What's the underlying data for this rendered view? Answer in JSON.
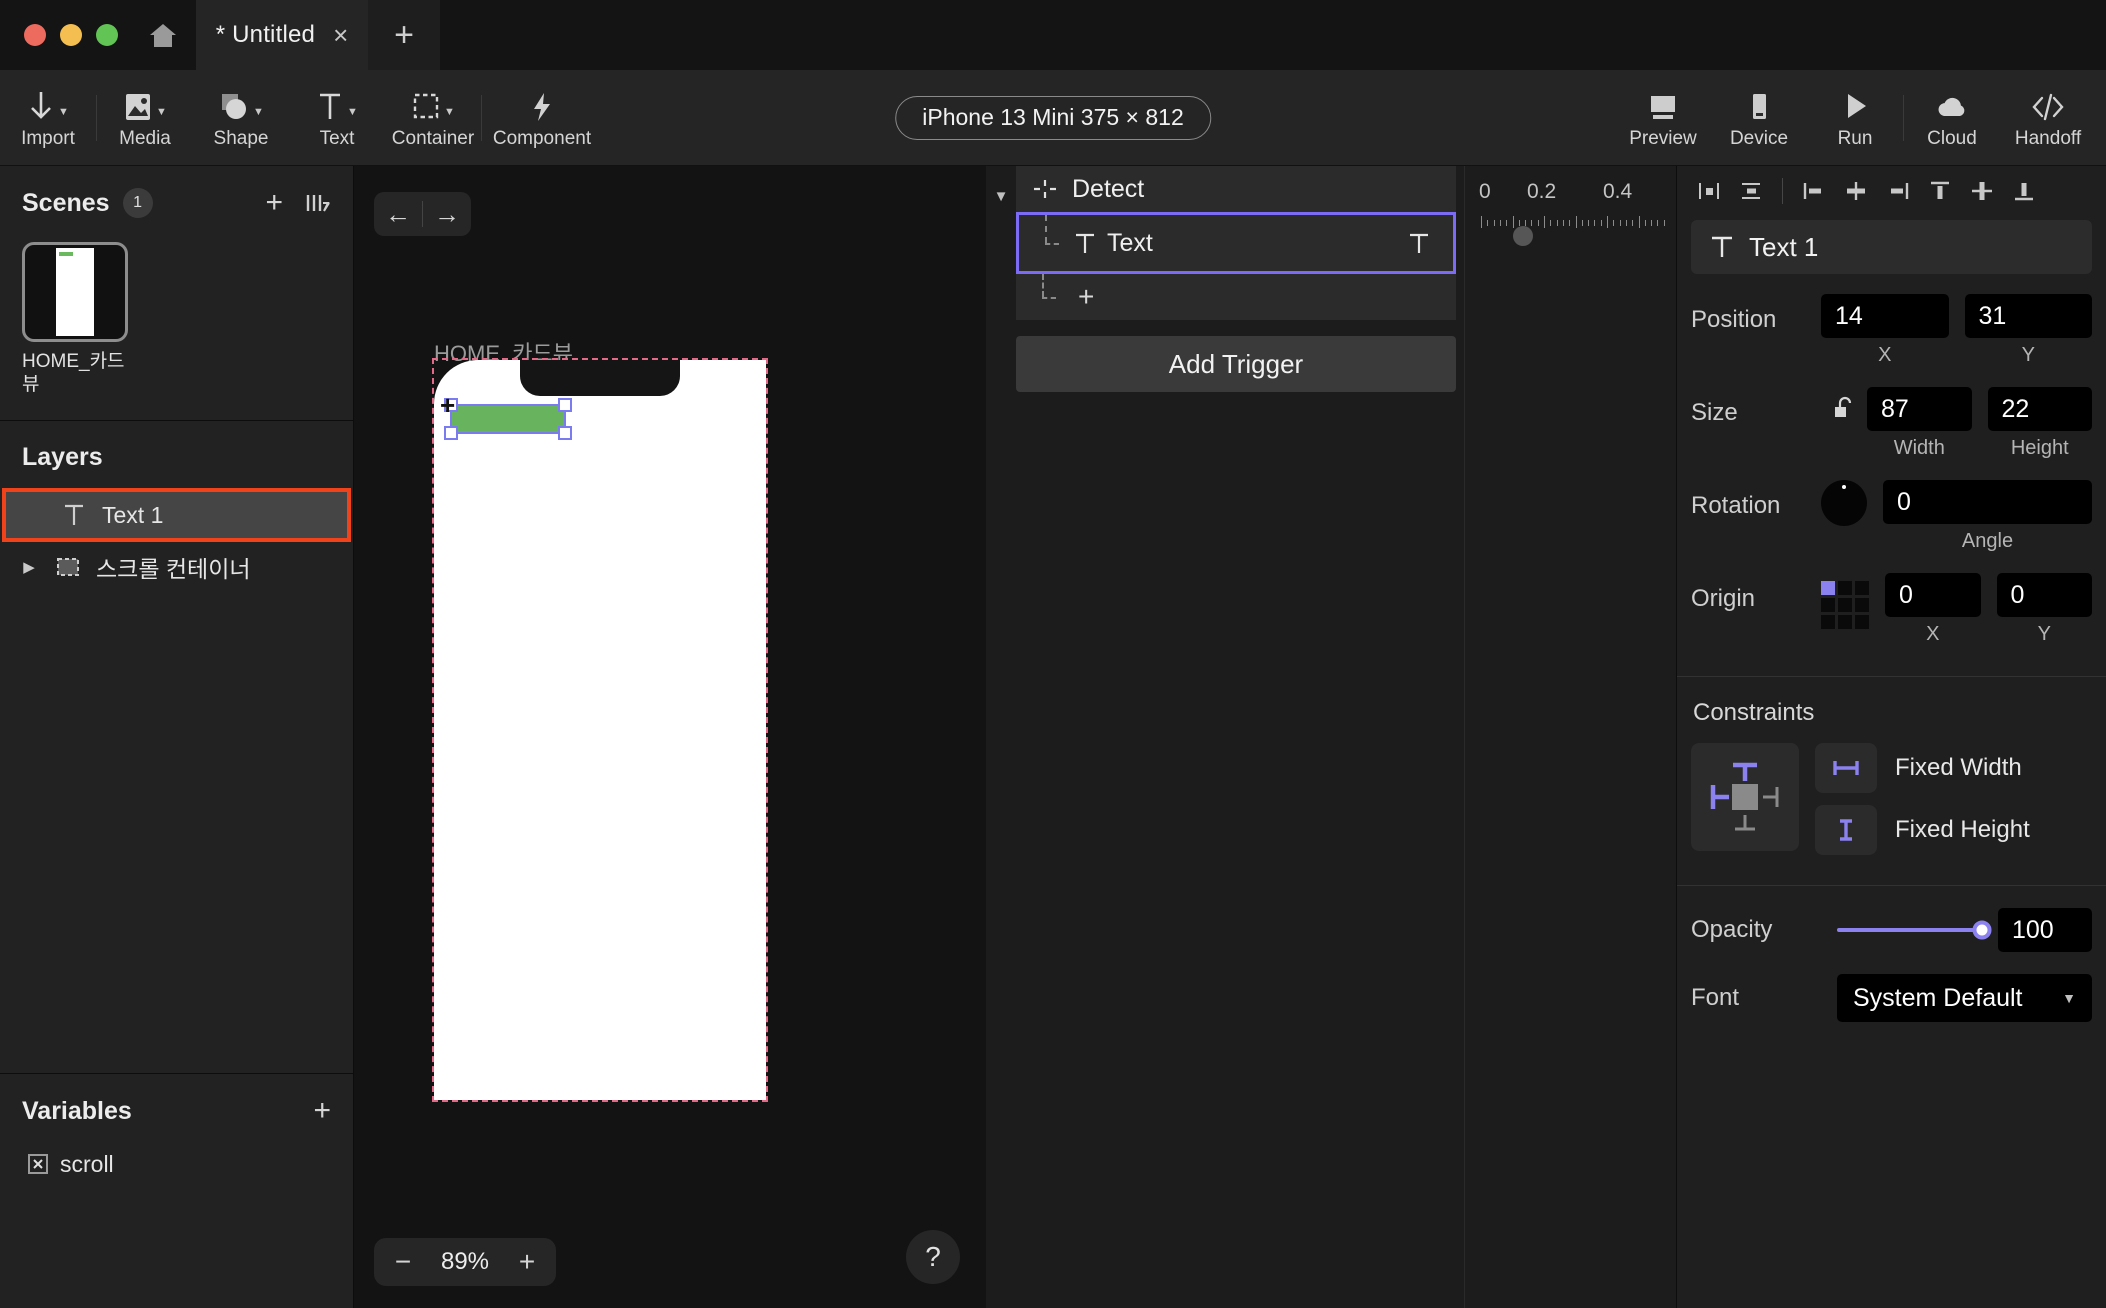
{
  "titlebar": {
    "home_icon": "home-icon",
    "tab_title": "* Untitled",
    "tab_close": "×",
    "new_tab": "+"
  },
  "toolbar": {
    "items": [
      {
        "label": "Import",
        "icon": "import-arrow-icon",
        "has_caret": true
      },
      {
        "label": "Media",
        "icon": "image-icon",
        "has_caret": true
      },
      {
        "label": "Shape",
        "icon": "shapes-icon",
        "has_caret": true
      },
      {
        "label": "Text",
        "icon": "text-t-icon",
        "has_caret": true
      },
      {
        "label": "Container",
        "icon": "dashed-box-icon",
        "has_caret": true
      },
      {
        "label": "Component",
        "icon": "lightning-icon",
        "has_caret": false
      }
    ],
    "device_chip": "iPhone 13 Mini  375 × 812",
    "right_items": [
      {
        "label": "Preview",
        "icon": "preview-window-icon"
      },
      {
        "label": "Device",
        "icon": "device-phone-icon"
      },
      {
        "label": "Run",
        "icon": "play-icon"
      },
      {
        "label": "Cloud",
        "icon": "cloud-icon"
      },
      {
        "label": "Handoff",
        "icon": "code-brackets-icon"
      }
    ]
  },
  "scenes": {
    "title": "Scenes",
    "count": "1",
    "add_label": "+",
    "sort_icon": "sort-bars-icon",
    "items": [
      {
        "label": "HOME_카드뷰"
      }
    ]
  },
  "layers": {
    "title": "Layers",
    "items": [
      {
        "label": "Text 1",
        "icon": "text-t-icon",
        "selected": true,
        "expandable": false
      },
      {
        "label": "스크롤 컨테이너",
        "icon": "dashed-box-icon",
        "selected": false,
        "expandable": true
      }
    ]
  },
  "variables": {
    "title": "Variables",
    "add_label": "+",
    "items": [
      {
        "label": "scroll",
        "icon": "variable-x-icon"
      }
    ]
  },
  "canvas": {
    "back_arrow": "←",
    "forward_arrow": "→",
    "artboard_label": "HOME_카드뷰",
    "zoom_out": "−",
    "zoom_value": "89%",
    "zoom_in": "+",
    "help": "?",
    "selection_fill": "#68b35e",
    "selection_stroke": "#7b7bf0",
    "artboard_outline": "#e36a86"
  },
  "triggers": {
    "collapse_icon": "chevron-down-icon",
    "detect_label": "Detect",
    "detect_icon": "detect-crosshair-icon",
    "rows": [
      {
        "label": "Text",
        "icon": "text-t-icon",
        "right_icon": "text-t-icon",
        "selected": true
      }
    ],
    "add_row": "+",
    "add_trigger_label": "Add Trigger"
  },
  "timeline": {
    "ticks": [
      "0",
      "0.2",
      "0.4"
    ]
  },
  "inspector": {
    "align_icons": [
      "distribute-horizontal-icon",
      "distribute-vertical-icon",
      "align-left-icon",
      "align-center-horizontal-icon",
      "align-right-icon",
      "align-top-icon",
      "align-center-vertical-icon",
      "align-bottom-icon"
    ],
    "layer_name": "Text 1",
    "layer_icon": "text-t-icon",
    "position": {
      "label": "Position",
      "x": "14",
      "y": "31",
      "x_sub": "X",
      "y_sub": "Y"
    },
    "size": {
      "label": "Size",
      "lock_icon": "unlock-icon",
      "width": "87",
      "height": "22",
      "width_sub": "Width",
      "height_sub": "Height"
    },
    "rotation": {
      "label": "Rotation",
      "angle": "0",
      "angle_sub": "Angle"
    },
    "origin": {
      "label": "Origin",
      "x": "0",
      "y": "0",
      "x_sub": "X",
      "y_sub": "Y",
      "selected_cell": 0
    },
    "constraints": {
      "title": "Constraints",
      "fixed_width_label": "Fixed Width",
      "fixed_height_label": "Fixed Height",
      "fixed_width_icon": "fixed-width-icon",
      "fixed_height_icon": "fixed-height-icon",
      "accent": "#8b82f0"
    },
    "opacity": {
      "label": "Opacity",
      "value": "100"
    },
    "font": {
      "label": "Font",
      "value": "System Default"
    }
  }
}
